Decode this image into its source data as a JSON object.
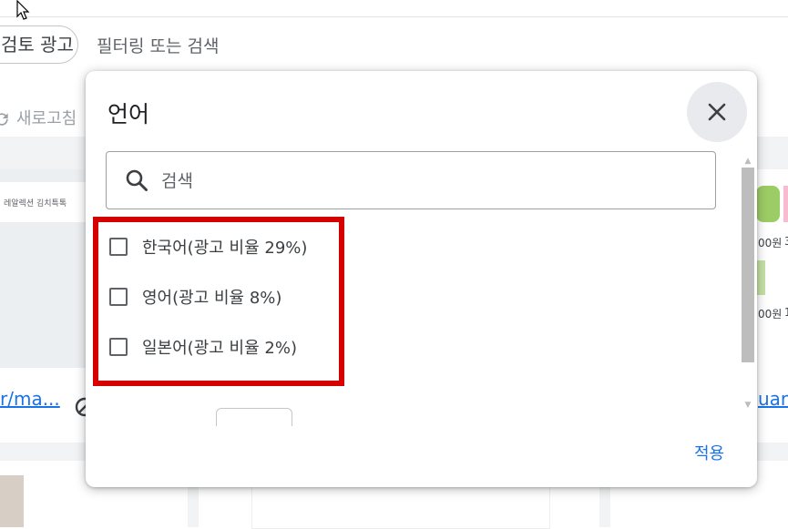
{
  "top_bar": {
    "chip_label": "검토 광고",
    "filter_placeholder": "필터링 또는 검색"
  },
  "toolbar": {
    "refresh_label": "새로고침"
  },
  "background": {
    "card_caption": "레알렉션 김치특톡",
    "link_left": "r/ma...",
    "link_right": "uard",
    "prices": [
      "00원",
      "3",
      "00원",
      "1"
    ]
  },
  "dialog": {
    "title": "언어",
    "search_placeholder": "검색",
    "options": [
      {
        "label": "한국어(광고 비율 29%)",
        "checked": false
      },
      {
        "label": "영어(광고 비율 8%)",
        "checked": false
      },
      {
        "label": "일본어(광고 비율 2%)",
        "checked": false
      }
    ],
    "apply_label": "적용"
  },
  "colors": {
    "accent": "#1a73e8",
    "highlight": "#d50000",
    "close_bg": "#e8eaed"
  },
  "icons": [
    "cursor-icon",
    "refresh-icon",
    "ban-icon",
    "close-icon",
    "search-icon"
  ]
}
